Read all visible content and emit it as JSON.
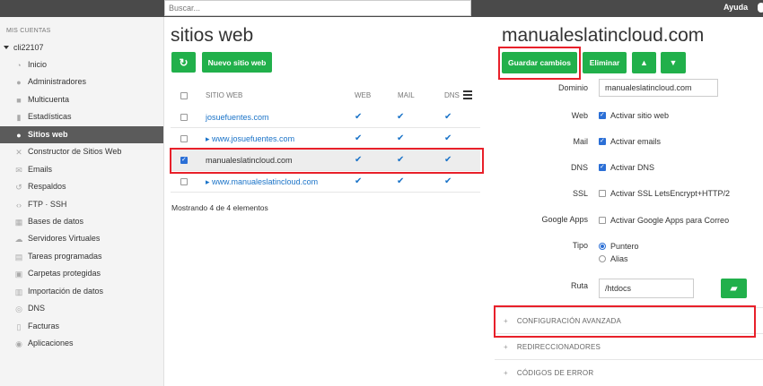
{
  "topbar": {
    "search_placeholder": "Buscar...",
    "help_label": "Ayuda"
  },
  "sidebar": {
    "heading": "MIS CUENTAS",
    "account": "cli22107",
    "items": [
      {
        "label": "Inicio",
        "icon": "speedometer-icon"
      },
      {
        "label": "Administradores",
        "icon": "users-icon"
      },
      {
        "label": "Multicuenta",
        "icon": "accounts-icon"
      },
      {
        "label": "Estadísticas",
        "icon": "bar-chart-icon"
      },
      {
        "label": "Sitios web",
        "icon": "globe-icon",
        "active": true
      },
      {
        "label": "Constructor de Sitios Web",
        "icon": "tools-icon"
      },
      {
        "label": "Emails",
        "icon": "envelope-icon"
      },
      {
        "label": "Respaldos",
        "icon": "history-icon"
      },
      {
        "label": "FTP · SSH",
        "icon": "code-icon"
      },
      {
        "label": "Bases de datos",
        "icon": "database-icon"
      },
      {
        "label": "Servidores Virtuales",
        "icon": "cloud-icon"
      },
      {
        "label": "Tareas programadas",
        "icon": "calendar-icon"
      },
      {
        "label": "Carpetas protegidas",
        "icon": "lock-icon"
      },
      {
        "label": "Importación de datos",
        "icon": "import-icon"
      },
      {
        "label": "DNS",
        "icon": "compass-icon"
      },
      {
        "label": "Facturas",
        "icon": "document-icon"
      },
      {
        "label": "Aplicaciones",
        "icon": "apps-icon"
      }
    ]
  },
  "sites": {
    "title": "sitios web",
    "new_button": "Nuevo sitio web",
    "columns": {
      "site": "SITIO WEB",
      "web": "WEB",
      "mail": "MAIL",
      "dns": "DNS"
    },
    "rows": [
      {
        "name": "josuefuentes.com",
        "alias": false,
        "checked": false,
        "web": "✔",
        "mail": "✔",
        "dns": "✔"
      },
      {
        "name": "▸ www.josuefuentes.com",
        "alias": true,
        "checked": false,
        "web": "✔",
        "mail": "✔",
        "dns": "✔"
      },
      {
        "name": "manualeslatincloud.com",
        "alias": false,
        "checked": true,
        "web": "✔",
        "mail": "✔",
        "dns": "✔"
      },
      {
        "name": "▸ www.manualeslatincloud.com",
        "alias": true,
        "checked": false,
        "web": "✔",
        "mail": "✔",
        "dns": "✔"
      }
    ],
    "footer": "Mostrando 4 de 4 elementos"
  },
  "detail": {
    "title": "manualeslatincloud.com",
    "save_button": "Guardar cambios",
    "delete_button": "Eliminar",
    "fields": {
      "dominio_label": "Dominio",
      "dominio_value": "manualeslatincloud.com",
      "web_label": "Web",
      "web_option": "Activar sitio web",
      "web_checked": true,
      "mail_label": "Mail",
      "mail_option": "Activar emails",
      "mail_checked": true,
      "dns_label": "DNS",
      "dns_option": "Activar DNS",
      "dns_checked": true,
      "ssl_label": "SSL",
      "ssl_option": "Activar SSL LetsEncrypt+HTTP/2",
      "ssl_checked": false,
      "gapps_label": "Google Apps",
      "gapps_option": "Activar Google Apps para Correo",
      "gapps_checked": false,
      "tipo_label": "Tipo",
      "tipo_option_1": "Puntero",
      "tipo_option_2": "Alias",
      "tipo_selected": "Puntero",
      "ruta_label": "Ruta",
      "ruta_value": "/htdocs"
    },
    "sections": [
      "CONFIGURACIÓN AVANZADA",
      "REDIRECCIONADORES",
      "CÓDIGOS DE ERROR"
    ]
  },
  "colors": {
    "accent": "#21b04b",
    "link": "#1a73c8",
    "highlight": "#e8202a",
    "active_sidebar": "#5b5b5b"
  }
}
